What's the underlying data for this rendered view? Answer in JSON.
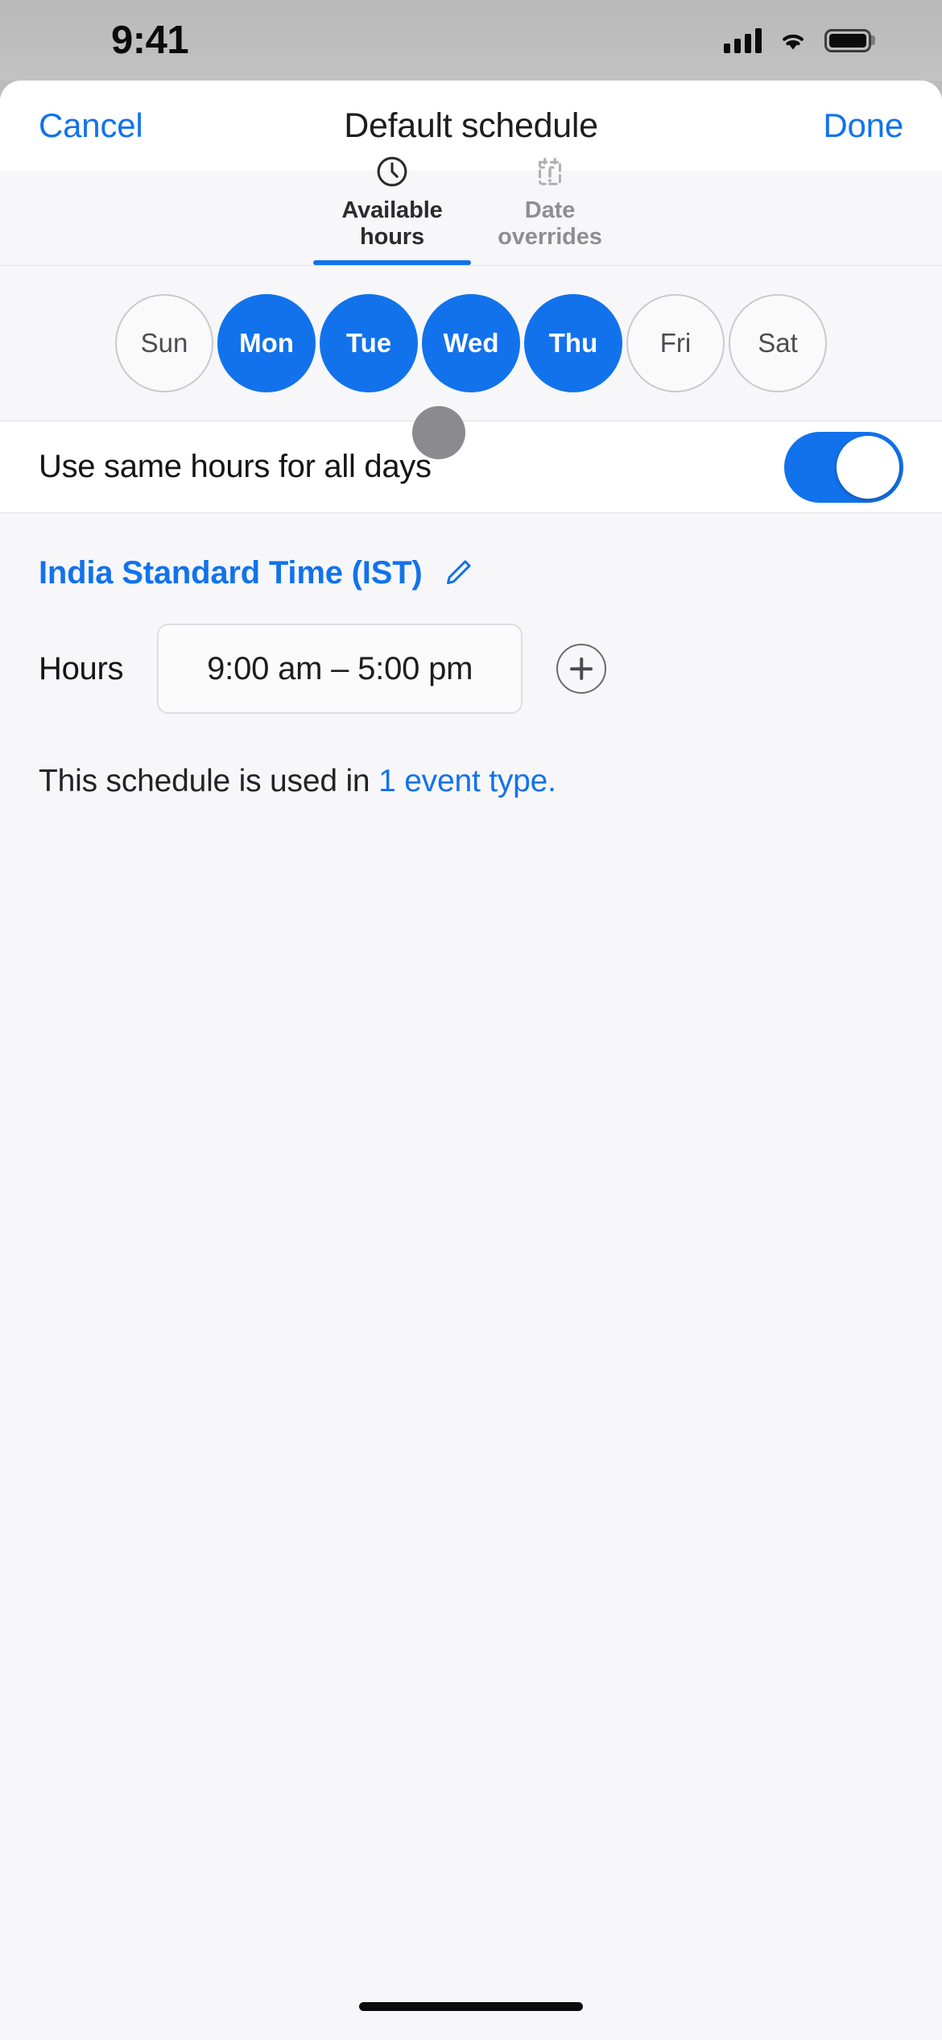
{
  "status_bar": {
    "time": "9:41",
    "cellular_icon": "cellular-bars-icon",
    "wifi_icon": "wifi-icon",
    "battery_icon": "battery-full-icon"
  },
  "navbar": {
    "cancel_label": "Cancel",
    "title": "Default schedule",
    "done_label": "Done"
  },
  "tabs": [
    {
      "label": "Available hours",
      "icon": "clock-icon",
      "active": true
    },
    {
      "label": "Date overrides",
      "icon": "calendar-alert-icon",
      "active": false
    }
  ],
  "days": [
    {
      "label": "Sun",
      "selected": false
    },
    {
      "label": "Mon",
      "selected": true
    },
    {
      "label": "Tue",
      "selected": true
    },
    {
      "label": "Wed",
      "selected": true
    },
    {
      "label": "Thu",
      "selected": true
    },
    {
      "label": "Fri",
      "selected": false
    },
    {
      "label": "Sat",
      "selected": false
    }
  ],
  "same_hours": {
    "label": "Use same hours for all days",
    "enabled": true
  },
  "timezone": {
    "label": "India Standard Time (IST)",
    "edit_icon": "pencil-edit-icon"
  },
  "hours": {
    "label": "Hours",
    "value": "9:00 am – 5:00 pm",
    "add_icon": "plus-circle-icon"
  },
  "footer": {
    "prefix": "This schedule is used in ",
    "link": "1 event type."
  },
  "colors": {
    "accent": "#1272ec",
    "sheet_bg": "#f7f7f9",
    "card_bg": "#ffffff",
    "muted_text": "#8e8e93",
    "border": "#e1e1e6",
    "tap_indicator": "#8b8b8f"
  }
}
